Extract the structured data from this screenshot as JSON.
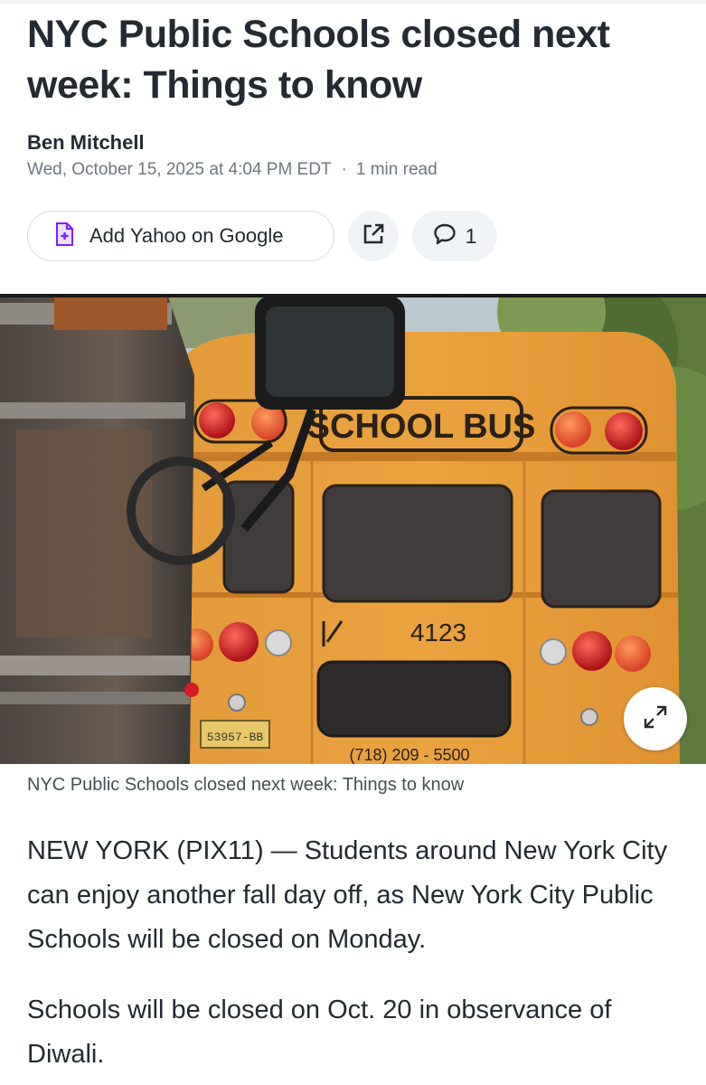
{
  "article": {
    "headline": "NYC Public Schools closed next week: Things to know",
    "author": "Ben Mitchell",
    "published": "Wed, October 15, 2025 at 4:04 PM EDT",
    "separator": "·",
    "read_time": "1 min read"
  },
  "actions": {
    "add_source_label": "Add Yahoo on Google",
    "add_source_icon": "add-to-google-icon",
    "share_icon": "share-external-icon",
    "comments_icon": "comment-bubble-icon",
    "comments_count": "1"
  },
  "hero": {
    "image_text_sign": "SCHOOL BUS",
    "image_text_number": "4123",
    "image_text_phone": "(718) 209 - 5500",
    "image_text_plate": "53957-BB",
    "expand_icon": "expand-icon",
    "caption": "NYC Public Schools closed next week: Things to know"
  },
  "body": {
    "paragraphs": [
      "NEW YORK (PIX11) — Students around New York City can enjoy another fall day off, as New York City Public Schools will be closed on Monday.",
      "Schools will be closed on Oct. 20 in observance of Diwali."
    ]
  },
  "colors": {
    "text": "#232a31",
    "muted": "#6e7780",
    "brand_purple": "#7e1fff",
    "bus_yellow": "#e89a2c"
  }
}
